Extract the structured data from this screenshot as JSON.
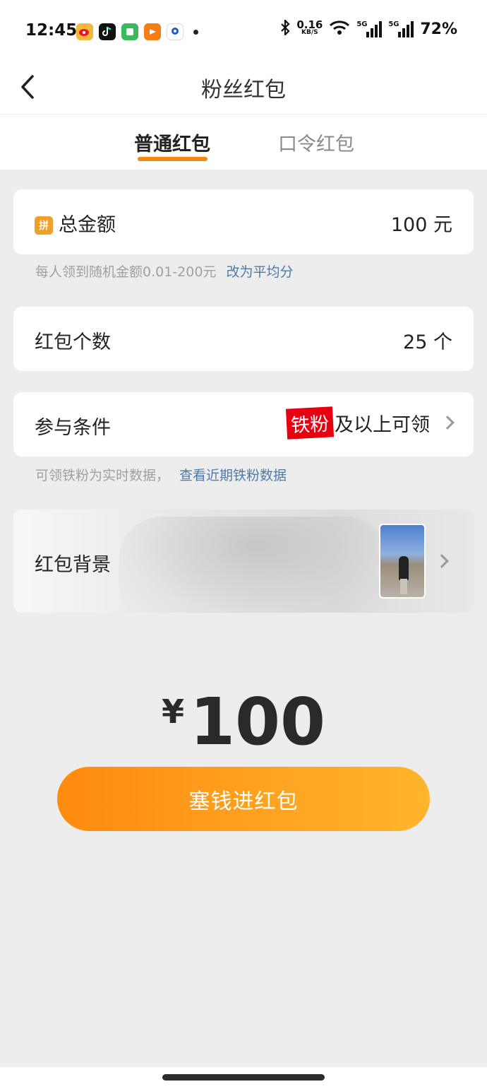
{
  "status_bar": {
    "time": "12:45",
    "net_speed_value": "0.16",
    "net_speed_unit": "KB/S",
    "signal1_label": "5G",
    "signal2_label": "5G",
    "battery": "72%"
  },
  "header": {
    "title": "粉丝红包"
  },
  "tabs": {
    "normal": "普通红包",
    "password": "口令红包",
    "active": "普通红包"
  },
  "total_amount": {
    "icon_text": "拼",
    "label": "总金额",
    "value": "100 元"
  },
  "amount_hint": {
    "text": "每人领到随机金额0.01-200元",
    "link": "改为平均分"
  },
  "count": {
    "label": "红包个数",
    "value": "25 个"
  },
  "condition": {
    "label": "参与条件",
    "badge": "铁粉",
    "suffix": "及以上可领"
  },
  "condition_hint": {
    "text": "可领铁粉为实时数据，",
    "link": "查看近期铁粉数据"
  },
  "background": {
    "label": "红包背景"
  },
  "summary": {
    "currency": "¥",
    "amount": "100"
  },
  "submit": {
    "label": "塞钱进红包"
  },
  "colors": {
    "accent": "#f28a10",
    "badge": "#e60012",
    "link": "#4f7aa8"
  }
}
